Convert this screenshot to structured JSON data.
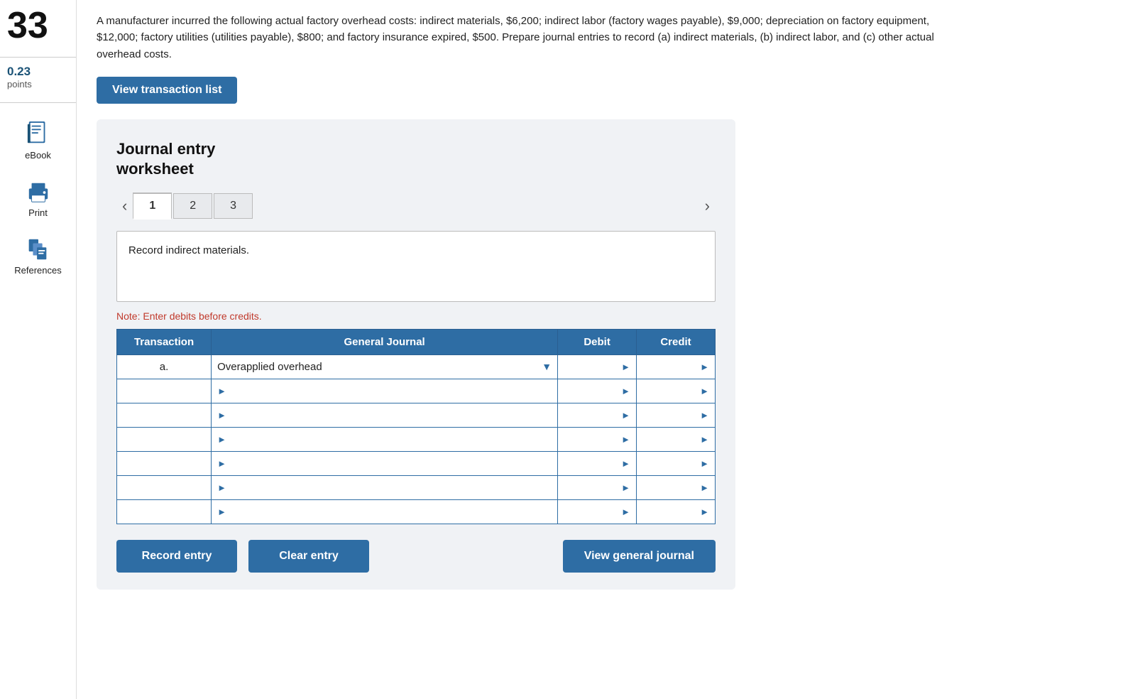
{
  "problem": {
    "number": "33",
    "score": "0.23",
    "score_label": "points"
  },
  "question": {
    "text": "A manufacturer incurred the following actual factory overhead costs: indirect materials, $6,200; indirect labor (factory wages payable), $9,000; depreciation on factory equipment, $12,000; factory utilities (utilities payable), $800; and factory insurance expired, $500. Prepare journal entries to record (a) indirect materials, (b) indirect labor, and (c) other actual overhead costs."
  },
  "sidebar": {
    "ebook_label": "eBook",
    "print_label": "Print",
    "references_label": "References"
  },
  "buttons": {
    "view_transaction": "View transaction list",
    "record_entry": "Record entry",
    "clear_entry": "Clear entry",
    "view_general_journal": "View general journal"
  },
  "worksheet": {
    "title": "Journal entry\nworksheet",
    "tabs": [
      {
        "label": "1",
        "active": true
      },
      {
        "label": "2",
        "active": false
      },
      {
        "label": "3",
        "active": false
      }
    ],
    "entry_description": "Record indirect materials.",
    "note": "Note: Enter debits before credits.",
    "table": {
      "headers": [
        "Transaction",
        "General Journal",
        "Debit",
        "Credit"
      ],
      "rows": [
        {
          "transaction": "a.",
          "journal": "Overapplied overhead",
          "debit": "",
          "credit": "",
          "has_dropdown": true,
          "is_dashed": true
        },
        {
          "transaction": "",
          "journal": "",
          "debit": "",
          "credit": "",
          "has_dropdown": false,
          "is_dashed": false
        },
        {
          "transaction": "",
          "journal": "",
          "debit": "",
          "credit": "",
          "has_dropdown": false,
          "is_dashed": false
        },
        {
          "transaction": "",
          "journal": "",
          "debit": "",
          "credit": "",
          "has_dropdown": false,
          "is_dashed": false
        },
        {
          "transaction": "",
          "journal": "",
          "debit": "",
          "credit": "",
          "has_dropdown": false,
          "is_dashed": false
        },
        {
          "transaction": "",
          "journal": "",
          "debit": "",
          "credit": "",
          "has_dropdown": false,
          "is_dashed": false
        },
        {
          "transaction": "",
          "journal": "",
          "debit": "",
          "credit": "",
          "has_dropdown": false,
          "is_dashed": false
        }
      ]
    }
  }
}
